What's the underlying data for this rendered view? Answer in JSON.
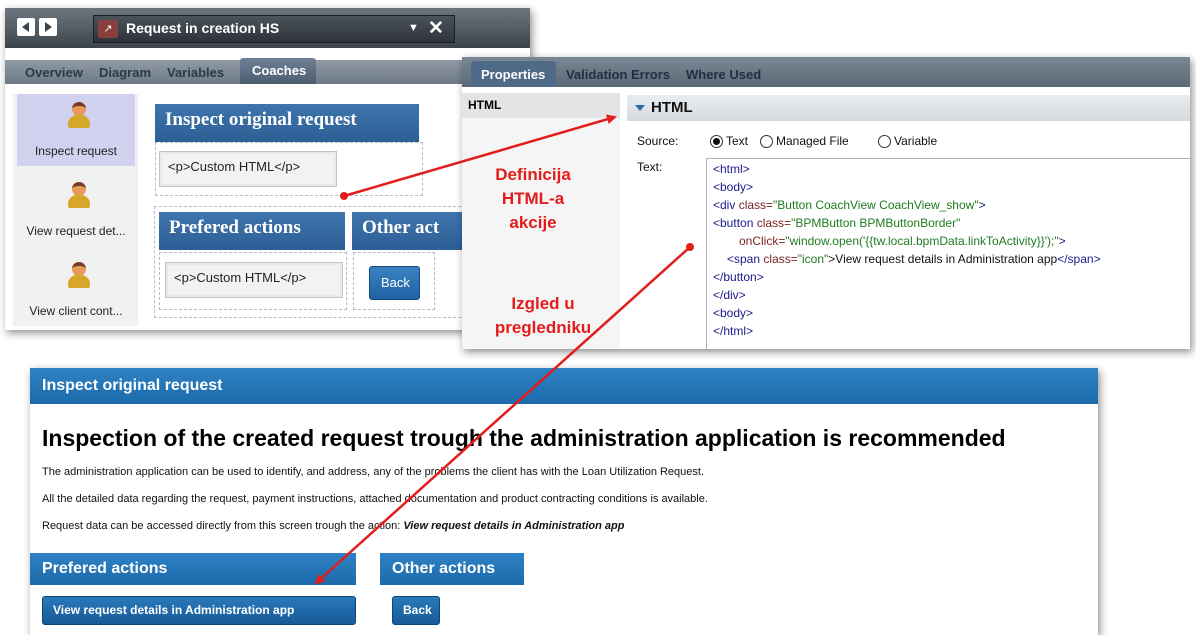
{
  "designer": {
    "title": "Request in creation HS",
    "tabs": [
      "Overview",
      "Diagram",
      "Variables",
      "Coaches"
    ],
    "activities": [
      "Inspect request",
      "View request det...",
      "View client cont..."
    ],
    "coach": {
      "header1": "Inspect original request",
      "custom_html_1": "<p>Custom HTML</p>",
      "header2": "Prefered actions",
      "header3": "Other act",
      "custom_html_2": "<p>Custom HTML</p>",
      "back": "Back"
    }
  },
  "properties": {
    "tabs": [
      "Properties",
      "Validation Errors",
      "Where Used"
    ],
    "left_item": "HTML",
    "section": "HTML",
    "source_label": "Source:",
    "source_options": [
      "Text",
      "Managed File",
      "Variable"
    ],
    "selected_source": "Text",
    "text_label": "Text:",
    "code": {
      "l1": "<html>",
      "l2": "<body>",
      "l3_tag": "<div ",
      "l3_attr": "class=",
      "l3_val": "\"Button CoachView CoachView_show\"",
      "l3_end": ">",
      "l4_tag": "<button ",
      "l4_attr": "class=",
      "l4_val": "\"BPMButton BPMButtonBorder\"",
      "l5_attr": "onClick=",
      "l5_val": "\"window.open('{{tw.local.bpmData.linkToActivity}}');\"",
      "l5_end": ">",
      "l6_tag": "<span ",
      "l6_attr": "class=",
      "l6_val": "\"icon\"",
      "l6_text": ">View request details in Administration app",
      "l6_close": "</span>",
      "l7": "</button>",
      "l8": "</div>",
      "l9": "<body>",
      "l10": "</html>"
    }
  },
  "preview": {
    "header": "Inspect original request",
    "heading": "Inspection of the created request trough the administration application is recommended",
    "p1": "The administration application can be used to identify, and address, any of the problems the client has with the Loan Utilization Request.",
    "p2": "All the detailed data regarding the request, payment instructions, attached documentation and product contracting conditions is available.",
    "p3": "Request data can be accessed directly from this screen trough the action: ",
    "p3_bold": "View request details in Administration app",
    "section1": "Prefered actions",
    "section2": "Other actions",
    "button1": "View request details in Administration app",
    "button2": "Back"
  },
  "annotations": {
    "a1_l1": "Definicija",
    "a1_l2": "HTML-a",
    "a1_l3": "akcije",
    "a2_l1": "Izgled u",
    "a2_l2": "pregledniku"
  },
  "colors": {
    "arrow": "#e31c1c",
    "coach_blue": "#2c5f95",
    "preview_blue": "#1c6aaa"
  }
}
